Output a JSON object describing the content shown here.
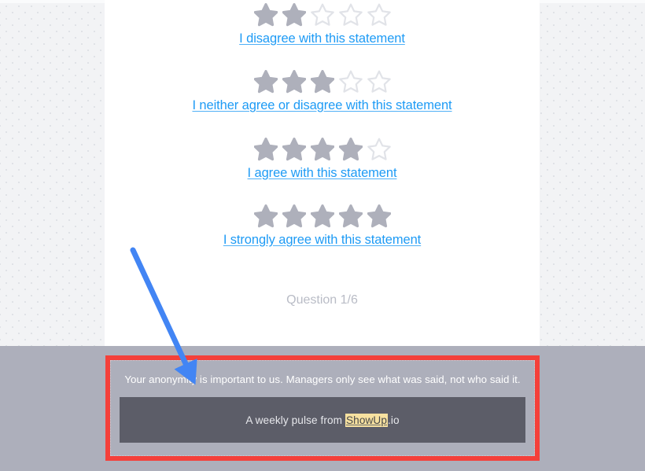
{
  "survey": {
    "ratings": [
      {
        "filled": 2,
        "total": 5,
        "label": "I disagree with this statement",
        "icon": "star-icon"
      },
      {
        "filled": 3,
        "total": 5,
        "label": "I neither agree or disagree with this statement",
        "icon": "star-icon"
      },
      {
        "filled": 4,
        "total": 5,
        "label": "I agree with this statement",
        "icon": "star-icon"
      },
      {
        "filled": 5,
        "total": 5,
        "label": "I strongly agree with this statement",
        "icon": "star-icon"
      }
    ],
    "question_counter": "Question 1/6"
  },
  "footer": {
    "anonymity_note": "Your anonymity is important to us. Managers only see what was said, not who said it.",
    "promo_prefix": "A weekly pulse from ",
    "promo_brand": "ShowUp",
    "promo_suffix": ".io"
  },
  "annotations": {
    "arrow": {
      "icon": "arrow-down-right-icon",
      "color": "#4285f4"
    },
    "highlight_box": {
      "icon": "rectangle-outline-icon",
      "color": "#f4403a"
    }
  },
  "colors": {
    "link": "#1e9bf5",
    "star_filled": "#aeb0bb",
    "star_empty": "#e1e3e8",
    "footer_bg": "#adafbb",
    "dark_bar_bg": "#5c5d68",
    "brand_highlight": "#f7e1a0",
    "annotation_red": "#f4403a",
    "annotation_blue": "#4285f4"
  }
}
